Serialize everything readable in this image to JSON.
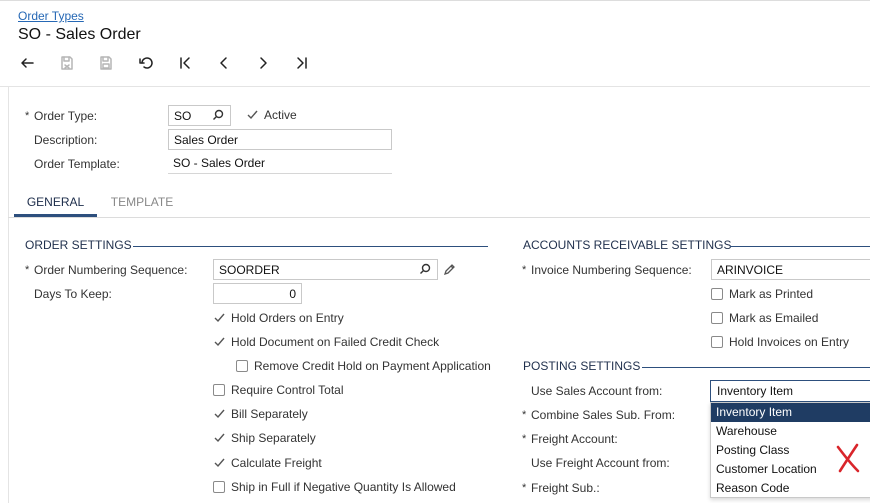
{
  "breadcrumb": "Order Types",
  "title": "SO - Sales Order",
  "toolbar": {
    "buttons": [
      "back-icon",
      "save-close-icon",
      "save-icon",
      "undo-icon",
      "first-record-icon",
      "previous-record-icon",
      "next-record-icon",
      "last-record-icon"
    ]
  },
  "header": {
    "order_type_label": "Order Type:",
    "order_type_value": "SO",
    "active_label": "Active",
    "description_label": "Description:",
    "description_value": "Sales Order",
    "template_label": "Order Template:",
    "template_value": "SO - Sales Order"
  },
  "tabs": [
    {
      "label": "GENERAL",
      "active": true
    },
    {
      "label": "TEMPLATE",
      "active": false
    }
  ],
  "order_settings": {
    "title": "ORDER SETTINGS",
    "numbering_label": "Order Numbering Sequence:",
    "numbering_value": "SOORDER",
    "days_label": "Days To Keep:",
    "days_value": "0",
    "checks": [
      {
        "label": "Hold Orders on Entry",
        "checked": true
      },
      {
        "label": "Hold Document on Failed Credit Check",
        "checked": true
      },
      {
        "label": "Remove Credit Hold on Payment Application",
        "checked": false
      },
      {
        "label": "Require Control Total",
        "checked": false
      },
      {
        "label": "Bill Separately",
        "checked": true
      },
      {
        "label": "Ship Separately",
        "checked": true
      },
      {
        "label": "Calculate Freight",
        "checked": true
      },
      {
        "label": "Ship in Full if Negative Quantity Is Allowed",
        "checked": false
      }
    ]
  },
  "ar_settings": {
    "title": "ACCOUNTS RECEIVABLE SETTINGS",
    "invoice_label": "Invoice Numbering Sequence:",
    "invoice_value": "ARINVOICE",
    "checks": [
      {
        "label": "Mark as Printed",
        "checked": false
      },
      {
        "label": "Mark as Emailed",
        "checked": false
      },
      {
        "label": "Hold Invoices on Entry",
        "checked": false
      }
    ]
  },
  "posting_settings": {
    "title": "POSTING SETTINGS",
    "sales_account_label": "Use Sales Account from:",
    "sales_account_value": "Inventory Item",
    "combine_label": "Combine Sales Sub. From:",
    "freight_account_label": "Freight Account:",
    "use_freight_label": "Use Freight Account from:",
    "freight_sub_label": "Freight Sub.:",
    "dropdown_options": [
      "Inventory Item",
      "Warehouse",
      "Posting Class",
      "Customer Location",
      "Reason Code"
    ]
  },
  "colors": {
    "accent": "#2d4f7d",
    "link": "#2668b5",
    "selected_bg": "#1f3c63",
    "cross": "#d9252b"
  }
}
